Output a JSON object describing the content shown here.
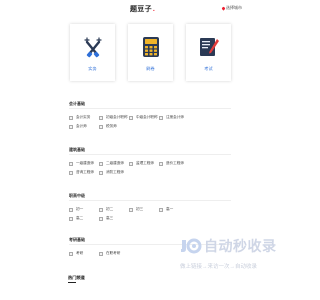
{
  "header": {
    "logo_text": "题豆子",
    "location_text": "选择城市"
  },
  "cards": [
    {
      "label": "实务",
      "icon": "tools-icon"
    },
    {
      "label": "刷卷",
      "icon": "calculator-icon"
    },
    {
      "label": "考试",
      "icon": "notebook-icon"
    }
  ],
  "sections": [
    {
      "title": "会计基础",
      "items": [
        "会计实务",
        "初级会计职称",
        "中级会计职称",
        "注册会计师",
        "会计师",
        "税务师"
      ]
    },
    {
      "title": "建筑基础",
      "items": [
        "一级建造师",
        "二级建造师",
        "监理工程师",
        "造价工程师",
        "咨询工程师",
        "消防工程师"
      ]
    },
    {
      "title": "职高中级",
      "items": [
        "初一",
        "初二",
        "初三",
        "高一",
        "高二",
        "高三"
      ]
    },
    {
      "title": "考研基础",
      "items": [
        "考研",
        "在职考研"
      ]
    }
  ],
  "footer": {
    "title": "热门频道"
  },
  "watermark": {
    "title": "自动秒收录",
    "subtitle": "做上链接→来访一次→自动收录"
  },
  "colors": {
    "accent_blue": "#2e6fd8",
    "brand_red": "#e22233",
    "watermark": "#cfd6e6"
  }
}
